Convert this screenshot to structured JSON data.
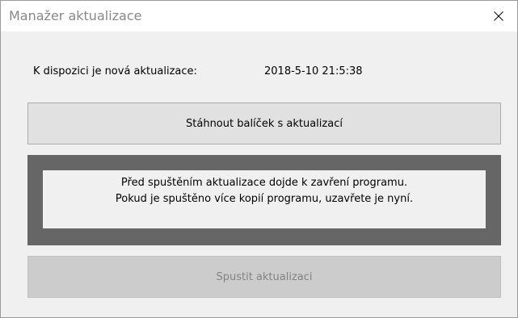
{
  "window": {
    "title": "Manažer aktualizace",
    "close_icon": "close-icon"
  },
  "update_info": {
    "label": "K dispozici je nová aktualizace:",
    "value": "2018-5-10 21:5:38"
  },
  "buttons": {
    "download_label": "Stáhnout balíček s aktualizací",
    "run_label": "Spustit aktualizaci",
    "run_enabled": false
  },
  "notice": {
    "line1": "Před spuštěním aktualizace dojde k zavření programu.",
    "line2": "Pokud je spuštěno více kopií programu, uzavřete je nyní."
  },
  "colors": {
    "notice_frame": "#666666",
    "window_background": "#f0f0f0",
    "disabled_text": "#838383"
  }
}
